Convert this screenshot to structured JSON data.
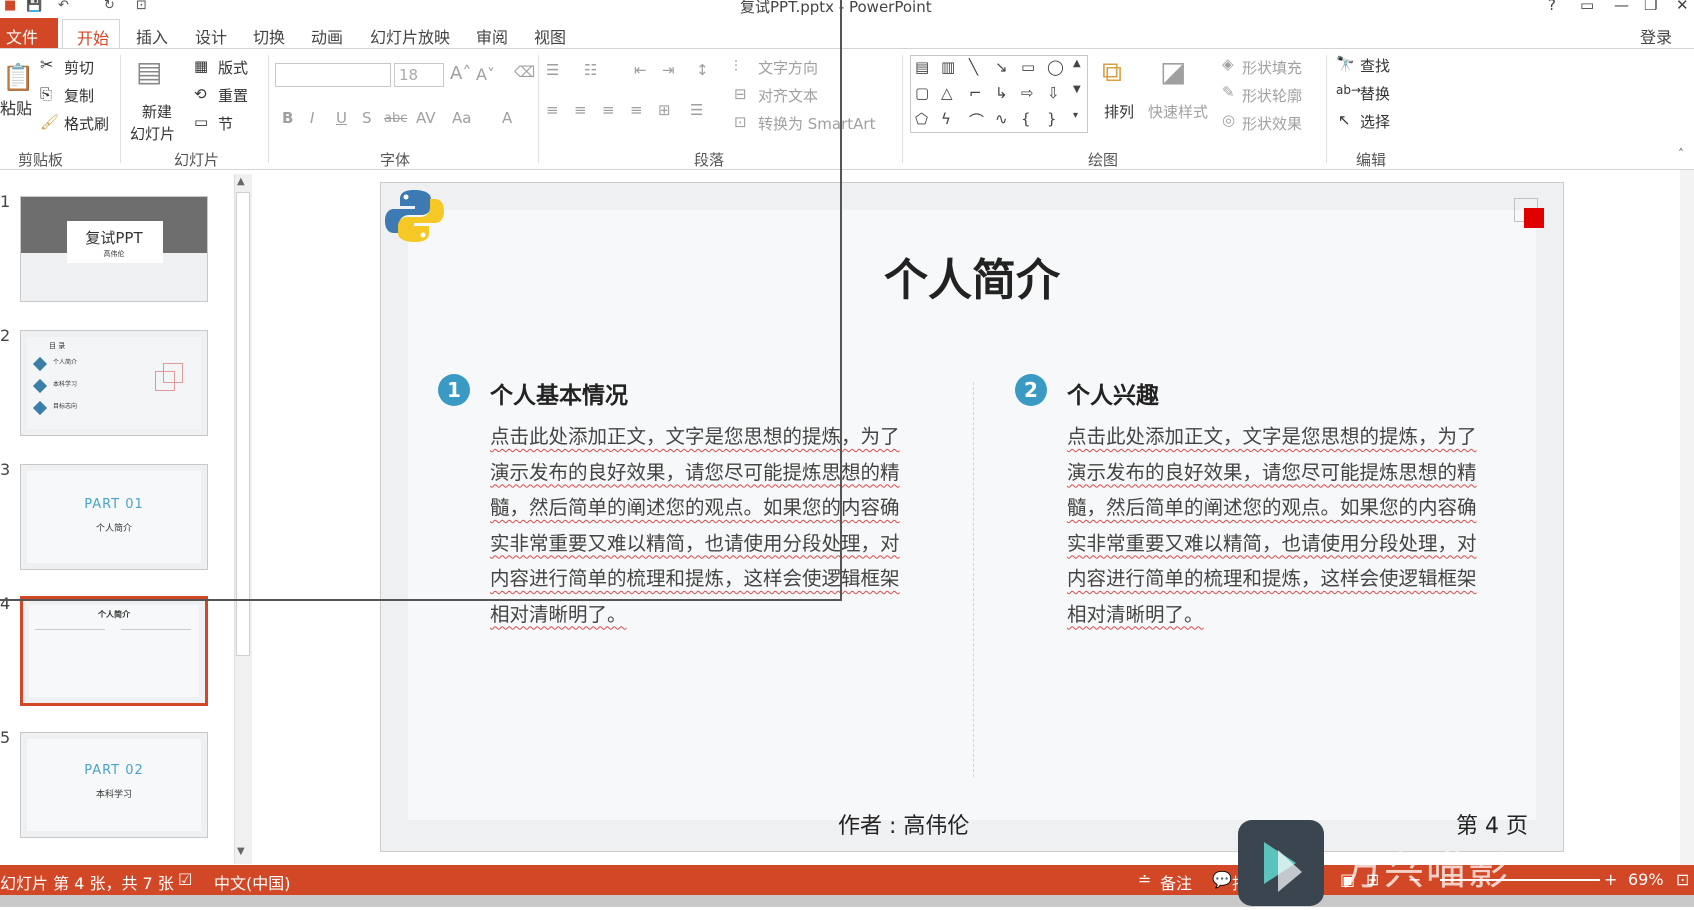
{
  "window": {
    "title": "复试PPT.pptx - PowerPoint",
    "login": "登录",
    "controls": [
      "?",
      "▭",
      "—",
      "❐",
      "✕"
    ]
  },
  "tabs": {
    "file": "文件",
    "home": "开始",
    "items": [
      "插入",
      "设计",
      "切换",
      "动画",
      "幻灯片放映",
      "审阅",
      "视图"
    ]
  },
  "ribbon": {
    "clipboard": {
      "paste": "粘贴",
      "cut": "剪切",
      "copy": "复制",
      "format_painter": "格式刷",
      "label": "剪贴板"
    },
    "slides": {
      "new_slide_1": "新建",
      "new_slide_2": "幻灯片",
      "layout": "版式",
      "reset": "重置",
      "section": "节",
      "label": "幻灯片"
    },
    "font": {
      "size": "18",
      "label": "字体"
    },
    "paragraph": {
      "text_direction": "文字方向",
      "align_text": "对齐文本",
      "smartart": "转换为 SmartArt",
      "label": "段落"
    },
    "drawing": {
      "arrange": "排列",
      "quick_styles": "快速样式",
      "fill": "形状填充",
      "outline": "形状轮廓",
      "effects": "形状效果",
      "label": "绘图"
    },
    "editing": {
      "find": "查找",
      "replace": "替换",
      "select": "选择",
      "label": "编辑"
    }
  },
  "thumbnails": [
    {
      "num": "1",
      "title": "复试PPT",
      "sub": "高伟伦"
    },
    {
      "num": "2",
      "title": "目 录",
      "items": [
        "个人简介",
        "本科学习",
        "目标志向"
      ]
    },
    {
      "num": "3",
      "part": "PART  01",
      "sub": "个人简介"
    },
    {
      "num": "4",
      "title": "个人简介"
    },
    {
      "num": "5",
      "part": "PART  02",
      "sub": "本科学习"
    }
  ],
  "slide": {
    "title": "个人简介",
    "section1": {
      "num": "1",
      "heading": "个人基本情况",
      "body": "点击此处添加正文，文字是您思想的提炼，为了演示发布的良好效果，请您尽可能提炼思想的精髓，然后简单的阐述您的观点。如果您的内容确实非常重要又难以精简，也请使用分段处理，对内容进行简单的梳理和提炼，这样会使逻辑框架相对清晰明了。"
    },
    "section2": {
      "num": "2",
      "heading": "个人兴趣",
      "body": "点击此处添加正文，文字是您思想的提炼，为了演示发布的良好效果，请您尽可能提炼思想的精髓，然后简单的阐述您的观点。如果您的内容确实非常重要又难以精简，也请使用分段处理，对内容进行简单的梳理和提炼，这样会使逻辑框架相对清晰明了。"
    },
    "author": "作者 : 高伟伦",
    "page": "第 4 页"
  },
  "status": {
    "slide_info": "幻灯片 第 4 张，共 7 张",
    "language": "中文(中国)",
    "notes": "备注",
    "comments": "批注",
    "zoom": "69%"
  },
  "watermark": "万兴喵影",
  "colors": {
    "accent": "#d24726",
    "blue": "#3b9ac4"
  }
}
